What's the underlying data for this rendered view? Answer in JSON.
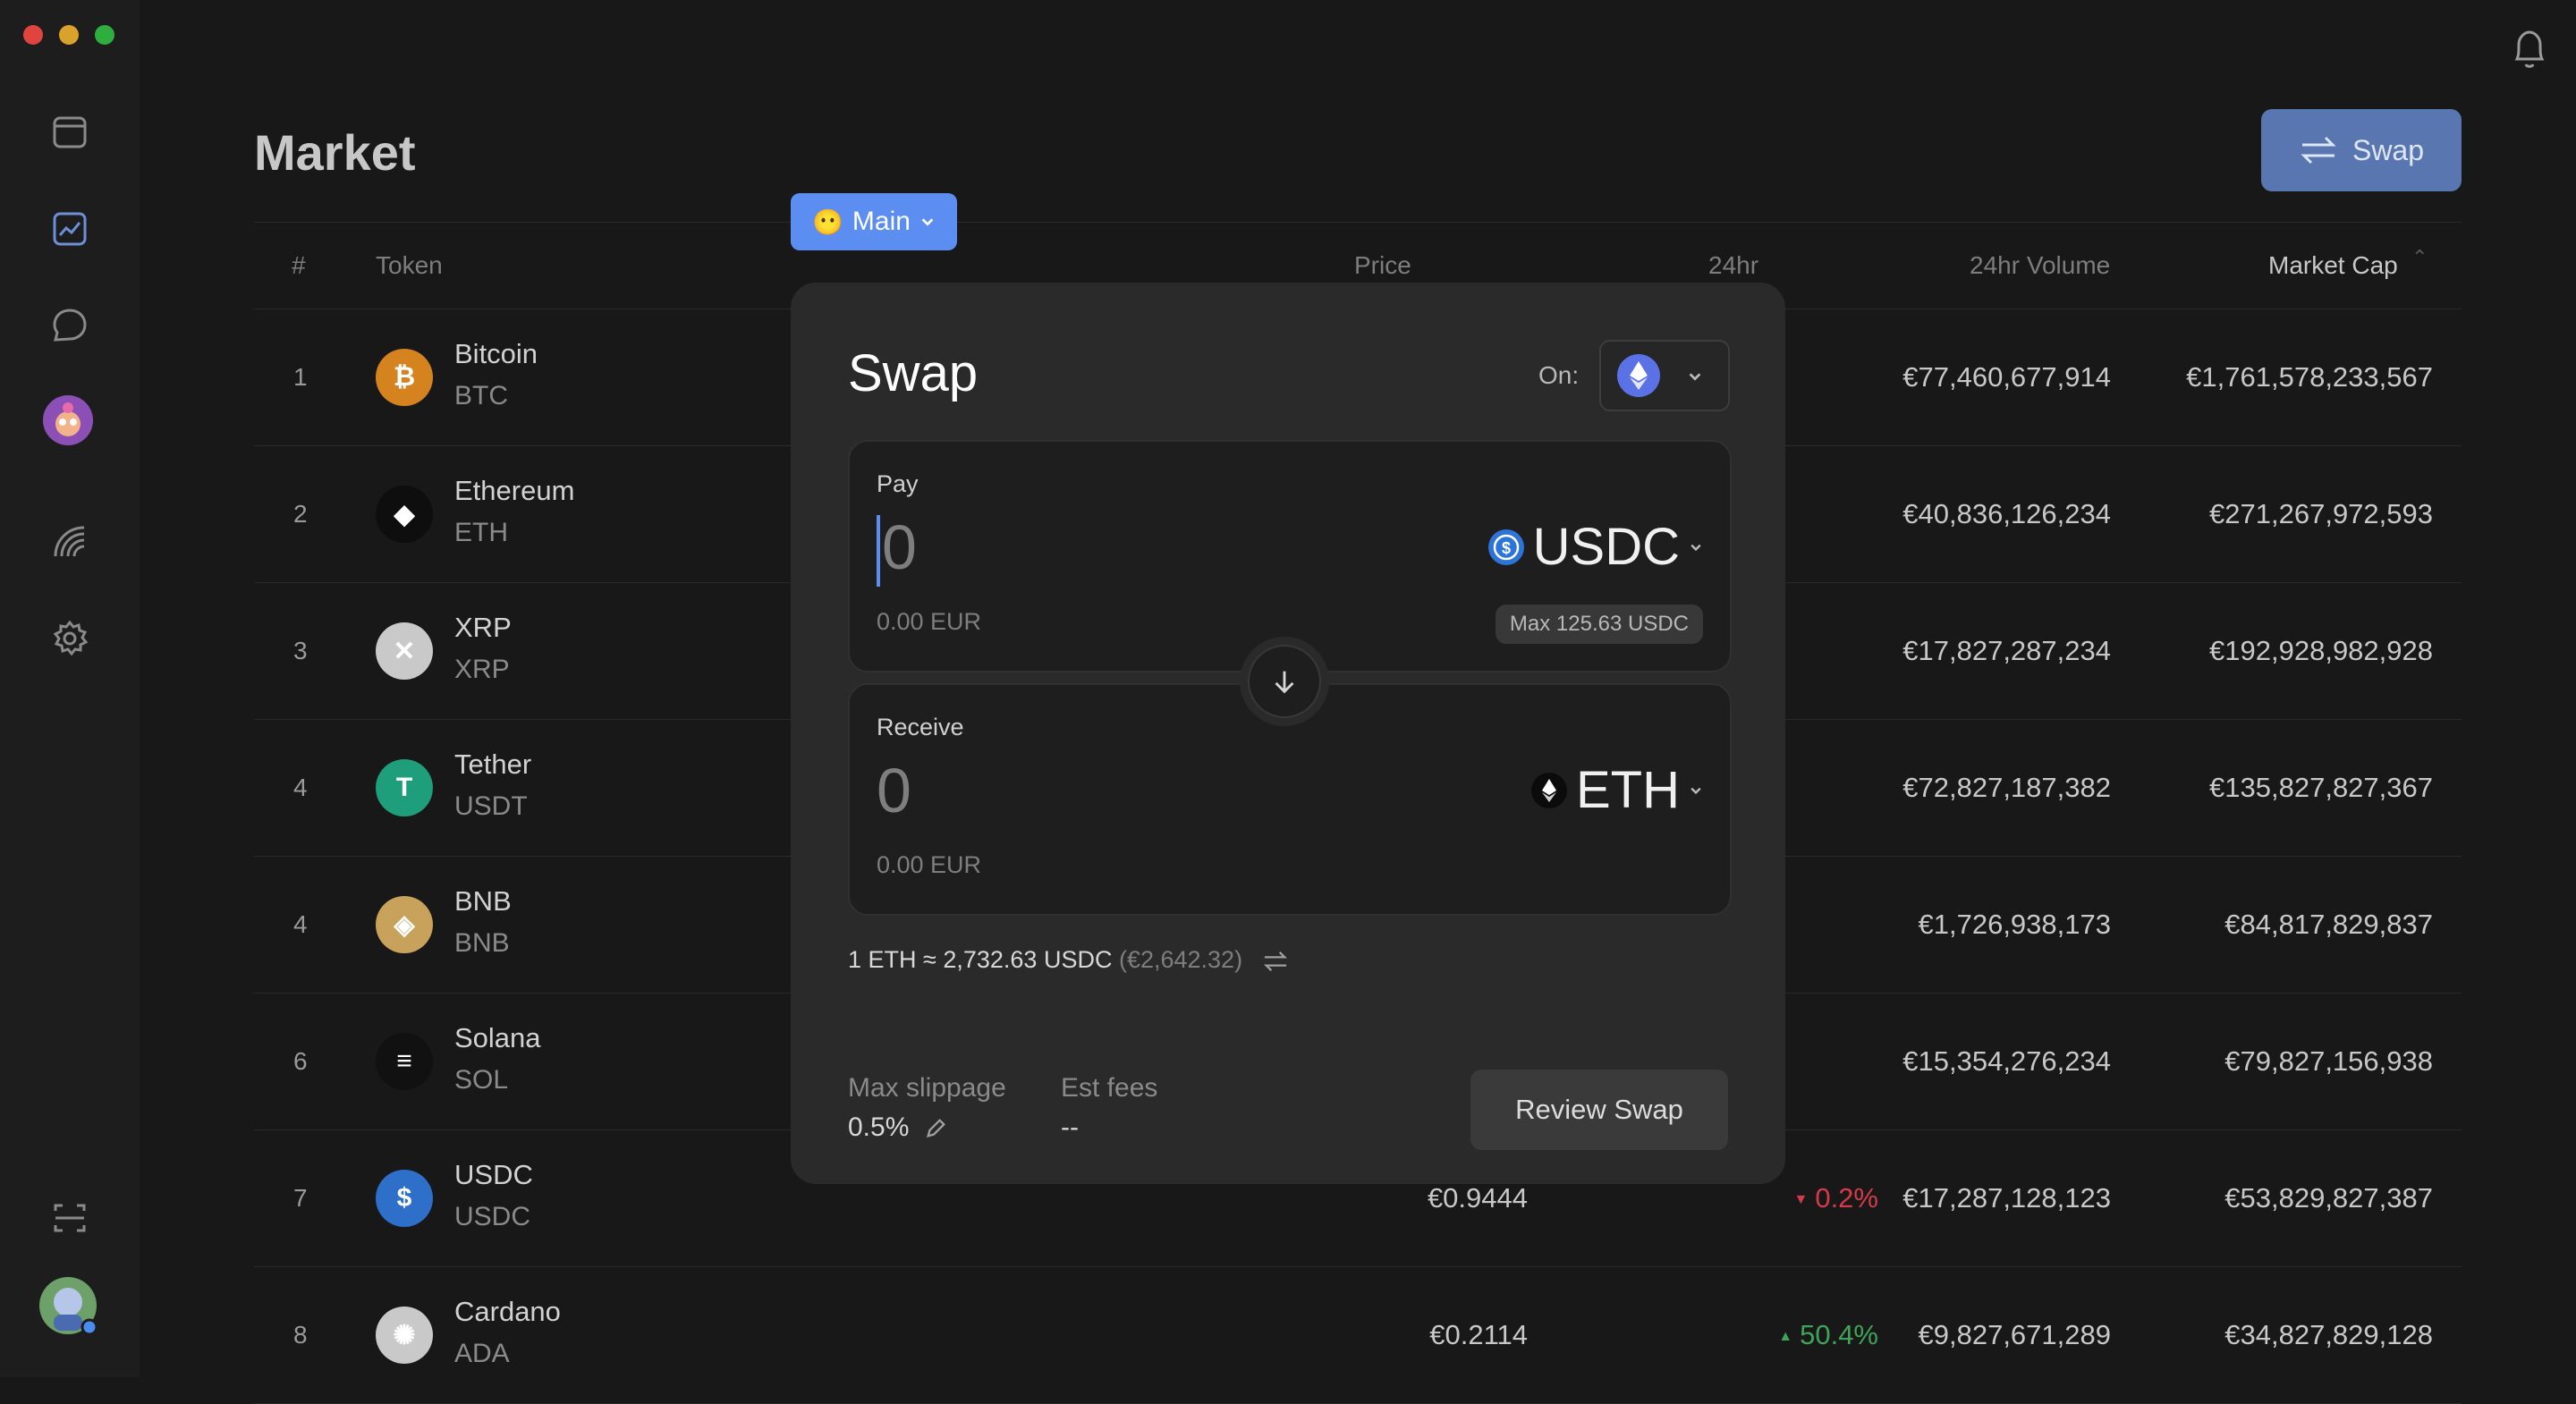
{
  "page": {
    "title": "Market"
  },
  "header": {
    "swap_button_label": "Swap"
  },
  "sidebar": {
    "items": [
      {
        "icon": "wallet-icon"
      },
      {
        "icon": "chart-icon"
      },
      {
        "icon": "chat-bubble-icon"
      },
      {
        "icon": "nft-avatar-icon"
      },
      {
        "icon": "rainbow-icon"
      },
      {
        "icon": "settings-gear-icon"
      }
    ],
    "bottom": [
      {
        "icon": "scan-icon"
      },
      {
        "icon": "profile-avatar-icon"
      }
    ]
  },
  "table": {
    "headers": {
      "rank": "#",
      "token": "Token",
      "price": "Price",
      "change": "24hr",
      "volume": "24hr Volume",
      "market_cap": "Market Cap"
    },
    "rows": [
      {
        "rank": "1",
        "name": "Bitcoin",
        "symbol": "BTC",
        "volume": "€77,460,677,914",
        "market_cap": "€1,761,578,233,567",
        "icon_color": "#d4831f",
        "glyph": "₿"
      },
      {
        "rank": "2",
        "name": "Ethereum",
        "symbol": "ETH",
        "volume": "€40,836,126,234",
        "market_cap": "€271,267,972,593",
        "icon_color": "#0e0e0e",
        "glyph": "◆"
      },
      {
        "rank": "3",
        "name": "XRP",
        "symbol": "XRP",
        "volume": "€17,827,287,234",
        "market_cap": "€192,928,982,928",
        "icon_color": "#c9c9c9",
        "glyph": "✕"
      },
      {
        "rank": "4",
        "name": "Tether",
        "symbol": "USDT",
        "volume": "€72,827,187,382",
        "market_cap": "€135,827,827,367",
        "icon_color": "#1f9e7c",
        "glyph": "T"
      },
      {
        "rank": "4",
        "name": "BNB",
        "symbol": "BNB",
        "volume": "€1,726,938,173",
        "market_cap": "€84,817,829,837",
        "icon_color": "#c8a25a",
        "glyph": "◈"
      },
      {
        "rank": "6",
        "name": "Solana",
        "symbol": "SOL",
        "volume": "€15,354,276,234",
        "market_cap": "€79,827,156,938",
        "icon_color": "#111111",
        "glyph": "≡"
      },
      {
        "rank": "7",
        "name": "USDC",
        "symbol": "USDC",
        "price": "€0.9444",
        "change": "0.2%",
        "change_dir": "down",
        "volume": "€17,287,128,123",
        "market_cap": "€53,829,827,387",
        "icon_color": "#2d6fc9",
        "glyph": "$"
      },
      {
        "rank": "8",
        "name": "Cardano",
        "symbol": "ADA",
        "price": "€0.2114",
        "change": "50.4%",
        "change_dir": "up",
        "volume": "€9,827,671,289",
        "market_cap": "€34,827,829,128",
        "icon_color": "#c9c9c9",
        "glyph": "✺"
      }
    ]
  },
  "account": {
    "label": "Main",
    "emoji": "😶"
  },
  "swap": {
    "title": "Swap",
    "on_label": "On:",
    "network_icon": "ethereum-icon",
    "pay": {
      "label": "Pay",
      "amount": "0",
      "fiat": "0.00 EUR",
      "token": "USDC",
      "max": "Max 125.63 USDC"
    },
    "receive": {
      "label": "Receive",
      "amount": "0",
      "fiat": "0.00 EUR",
      "token": "ETH"
    },
    "rate": "1 ETH ≈ 2,732.63 USDC",
    "rate_fiat": "(€2,642.32)",
    "max_slippage_label": "Max slippage",
    "max_slippage_value": "0.5%",
    "est_fees_label": "Est fees",
    "est_fees_value": "--",
    "review_label": "Review Swap"
  },
  "colors": {
    "accent": "#5b8ef0",
    "positive": "#3fa35a",
    "negative": "#d63a4a"
  }
}
